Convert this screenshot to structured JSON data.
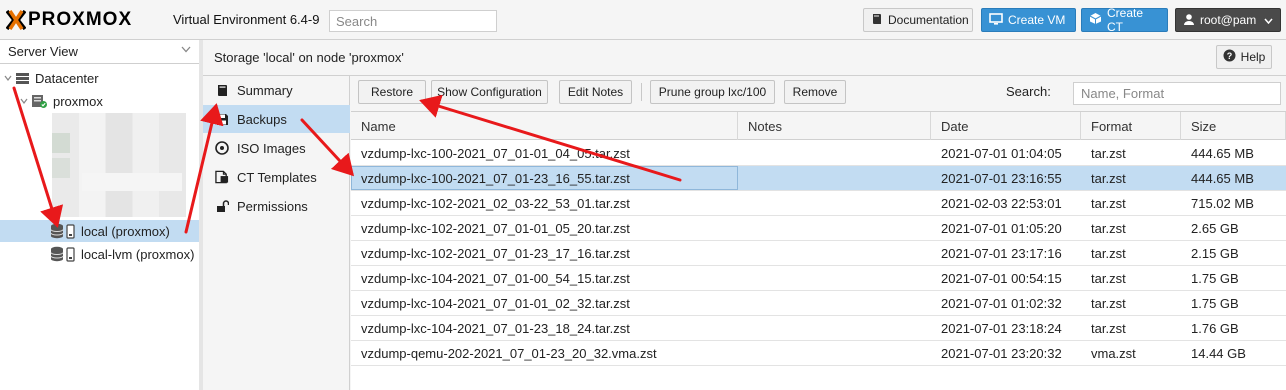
{
  "topbar": {
    "logo_text": "PROXMOX",
    "product": "Virtual Environment 6.4-9",
    "search_placeholder": "Search",
    "documentation": "Documentation",
    "create_vm": "Create VM",
    "create_ct": "Create CT",
    "user": "root@pam"
  },
  "tree": {
    "view": "Server View",
    "datacenter": "Datacenter",
    "node": "proxmox",
    "storages": [
      "local (proxmox)",
      "local-lvm (proxmox)"
    ]
  },
  "content": {
    "title": "Storage 'local' on node 'proxmox'",
    "help": "Help"
  },
  "submenu": [
    {
      "label": "Summary",
      "icon": "book-icon"
    },
    {
      "label": "Backups",
      "icon": "floppy-icon"
    },
    {
      "label": "ISO Images",
      "icon": "disc-icon"
    },
    {
      "label": "CT Templates",
      "icon": "template-icon"
    },
    {
      "label": "Permissions",
      "icon": "unlock-icon"
    }
  ],
  "toolbar": {
    "restore": "Restore",
    "show_config": "Show Configuration",
    "edit_notes": "Edit Notes",
    "prune": "Prune group lxc/100",
    "remove": "Remove",
    "search_label": "Search:",
    "search_placeholder": "Name, Format"
  },
  "grid": {
    "columns": [
      "Name",
      "Notes",
      "Date",
      "Format",
      "Size"
    ],
    "rows": [
      {
        "name": "vzdump-lxc-100-2021_07_01-01_04_05.tar.zst",
        "notes": "",
        "date": "2021-07-01 01:04:05",
        "format": "tar.zst",
        "size": "444.65 MB"
      },
      {
        "name": "vzdump-lxc-100-2021_07_01-23_16_55.tar.zst",
        "notes": "",
        "date": "2021-07-01 23:16:55",
        "format": "tar.zst",
        "size": "444.65 MB",
        "selected": true
      },
      {
        "name": "vzdump-lxc-102-2021_02_03-22_53_01.tar.zst",
        "notes": "",
        "date": "2021-02-03 22:53:01",
        "format": "tar.zst",
        "size": "715.02 MB"
      },
      {
        "name": "vzdump-lxc-102-2021_07_01-01_05_20.tar.zst",
        "notes": "",
        "date": "2021-07-01 01:05:20",
        "format": "tar.zst",
        "size": "2.65 GB"
      },
      {
        "name": "vzdump-lxc-102-2021_07_01-23_17_16.tar.zst",
        "notes": "",
        "date": "2021-07-01 23:17:16",
        "format": "tar.zst",
        "size": "2.15 GB"
      },
      {
        "name": "vzdump-lxc-104-2021_07_01-00_54_15.tar.zst",
        "notes": "",
        "date": "2021-07-01 00:54:15",
        "format": "tar.zst",
        "size": "1.75 GB"
      },
      {
        "name": "vzdump-lxc-104-2021_07_01-01_02_32.tar.zst",
        "notes": "",
        "date": "2021-07-01 01:02:32",
        "format": "tar.zst",
        "size": "1.75 GB"
      },
      {
        "name": "vzdump-lxc-104-2021_07_01-23_18_24.tar.zst",
        "notes": "",
        "date": "2021-07-01 23:18:24",
        "format": "tar.zst",
        "size": "1.76 GB"
      },
      {
        "name": "vzdump-qemu-202-2021_07_01-23_20_32.vma.zst",
        "notes": "",
        "date": "2021-07-01 23:20:32",
        "format": "vma.zst",
        "size": "14.44 GB"
      }
    ]
  },
  "colors": {
    "accent": "#3892d4",
    "selection": "#c2dcf2",
    "arrow": "#e8191b"
  }
}
